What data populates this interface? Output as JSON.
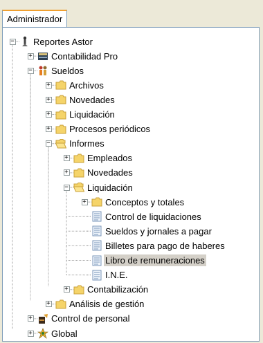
{
  "tab": {
    "label": "Administrador"
  },
  "tree": {
    "nodes": [
      {
        "label": "Reportes Astor",
        "icon": "astor-root-icon",
        "expander": "−"
      },
      {
        "label": "Contabilidad Pro",
        "icon": "ledger-book-icon",
        "expander": "+"
      },
      {
        "label": "Sueldos",
        "icon": "payroll-people-icon",
        "expander": "−"
      },
      {
        "label": "Archivos",
        "icon": "folder-icon",
        "expander": "+"
      },
      {
        "label": "Novedades",
        "icon": "folder-icon",
        "expander": "+"
      },
      {
        "label": "Liquidación",
        "icon": "folder-icon",
        "expander": "+"
      },
      {
        "label": "Procesos periódicos",
        "icon": "folder-icon",
        "expander": "+"
      },
      {
        "label": "Informes",
        "icon": "folder-open-icon",
        "expander": "−"
      },
      {
        "label": "Empleados",
        "icon": "folder-icon",
        "expander": "+"
      },
      {
        "label": "Novedades",
        "icon": "folder-icon",
        "expander": "+"
      },
      {
        "label": "Liquidación",
        "icon": "folder-open-icon",
        "expander": "−"
      },
      {
        "label": "Conceptos y totales",
        "icon": "folder-icon",
        "expander": "+"
      },
      {
        "label": "Control de liquidaciones",
        "icon": "report-icon",
        "expander": ""
      },
      {
        "label": "Sueldos y jornales a pagar",
        "icon": "report-icon",
        "expander": ""
      },
      {
        "label": "Billetes para pago de haberes",
        "icon": "report-icon",
        "expander": ""
      },
      {
        "label": "Libro de remuneraciones",
        "icon": "report-icon",
        "expander": "",
        "selected": true
      },
      {
        "label": "I.N.E.",
        "icon": "report-icon",
        "expander": ""
      },
      {
        "label": "Contabilización",
        "icon": "folder-icon",
        "expander": "+"
      },
      {
        "label": "Análisis de gestión",
        "icon": "folder-icon",
        "expander": "+"
      },
      {
        "label": "Control de personal",
        "icon": "personnel-control-icon",
        "expander": "+"
      },
      {
        "label": "Global",
        "icon": "global-icon",
        "expander": "+"
      }
    ]
  },
  "colors": {
    "selection": "#d4d0c8",
    "folder": "#f5d46a",
    "folder_border": "#c9a13a",
    "tab_accent": "#f0a030"
  }
}
